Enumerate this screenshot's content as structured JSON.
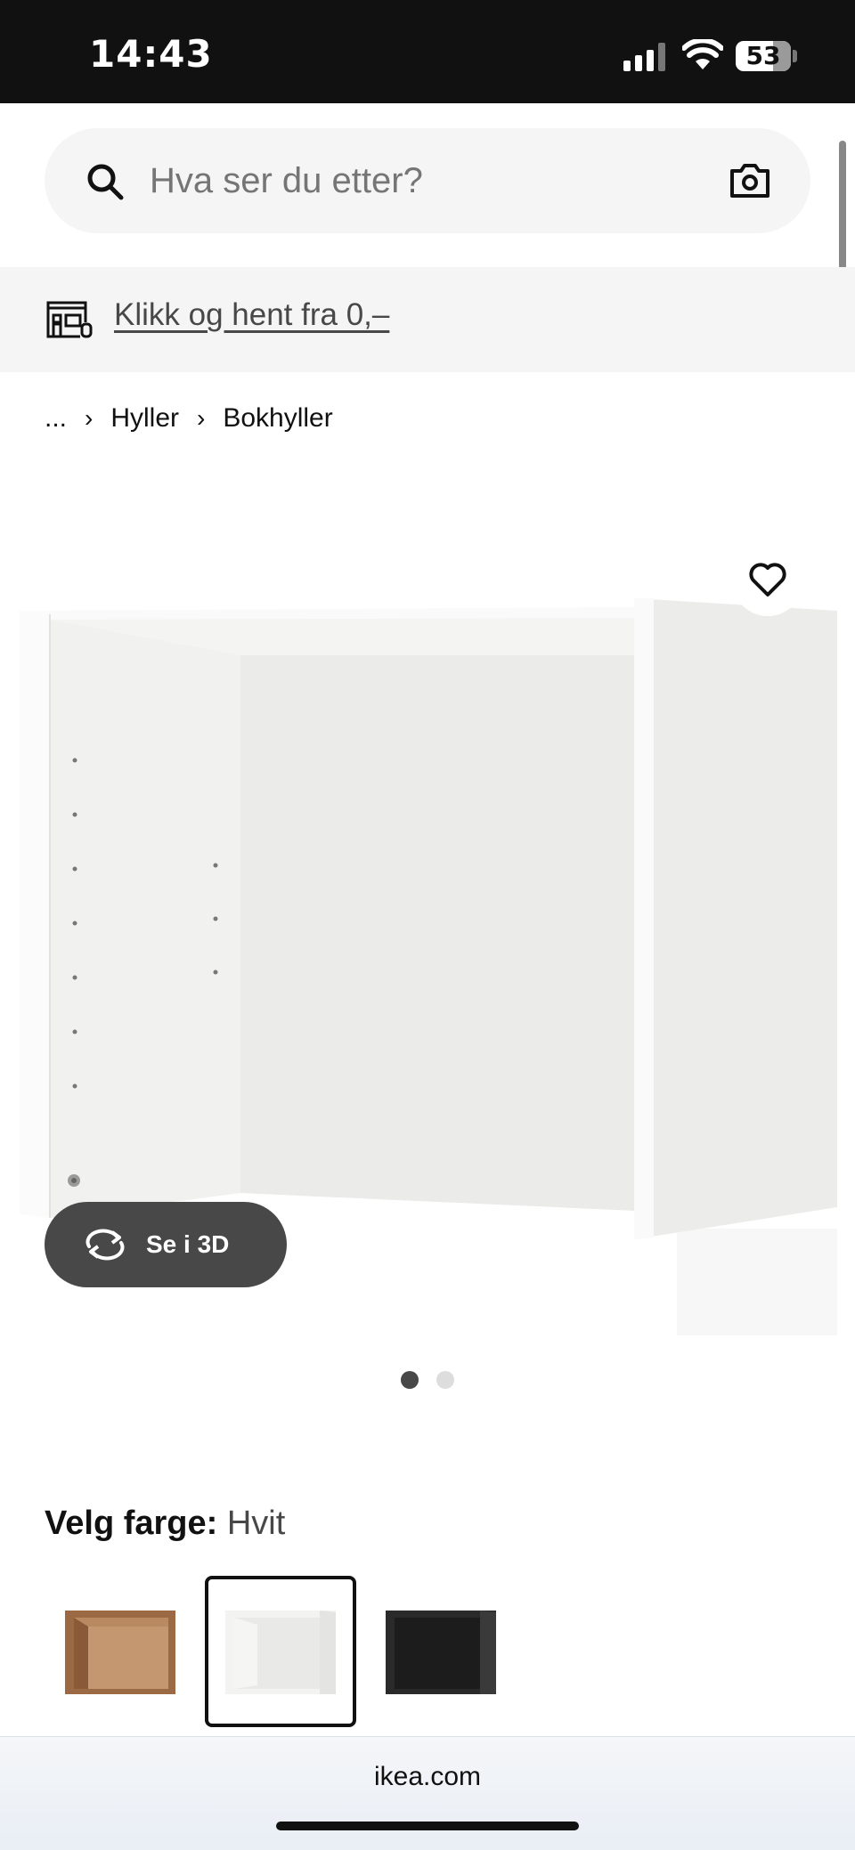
{
  "status_bar": {
    "time": "14:43",
    "battery": "53"
  },
  "search": {
    "placeholder": "Hva ser du etter?"
  },
  "promo": {
    "link_text": "Klikk og hent fra 0,–"
  },
  "breadcrumb": {
    "items": [
      "...",
      "Hyller",
      "Bokhyller"
    ]
  },
  "product": {
    "view3d_label": "Se i 3D",
    "gallery_count": 2,
    "gallery_active": 1
  },
  "color": {
    "label": "Velg farge:",
    "value": "Hvit",
    "options": [
      "walnut",
      "white",
      "black-brown"
    ],
    "selected": "white"
  },
  "browser": {
    "url": "ikea.com"
  },
  "colors": {
    "accent_dark": "#484848",
    "bg_light": "#f5f5f5"
  }
}
